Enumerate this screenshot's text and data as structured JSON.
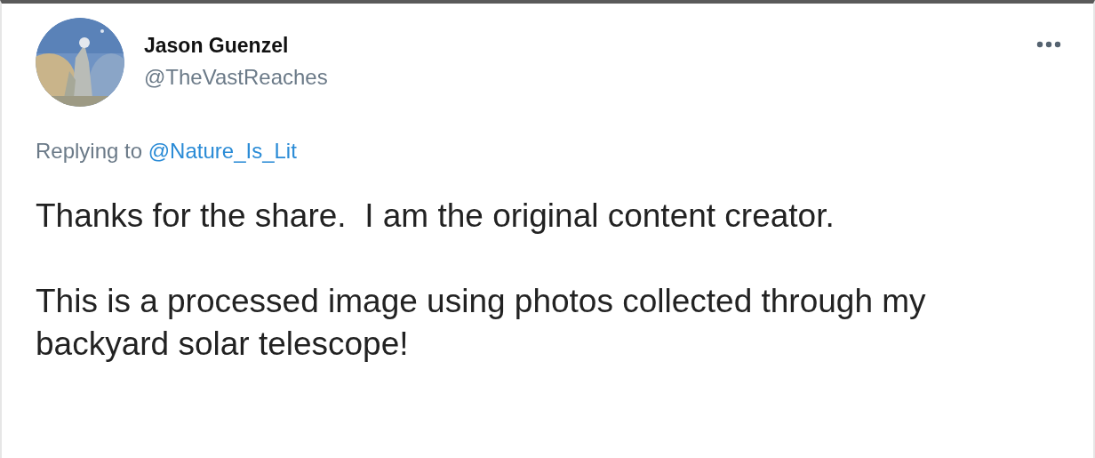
{
  "tweet": {
    "author": {
      "name": "Jason Guenzel",
      "handle": "@TheVastReaches"
    },
    "reply": {
      "prefix": "Replying to",
      "mention": "@Nature_Is_Lit"
    },
    "paragraphs": [
      "Thanks for the share.  I am the original content creator.",
      "This is a processed image using photos collected through my backyard solar telescope!"
    ]
  }
}
